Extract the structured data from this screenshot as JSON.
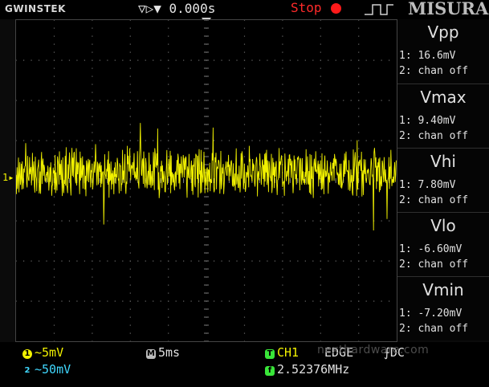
{
  "header": {
    "brand": "GWINSTEK",
    "timebase_offset": "0.000s",
    "run_status": "Stop",
    "logo": "MISURA"
  },
  "channel": {
    "marker": "1",
    "trace_color": "#f2f200"
  },
  "measurements": [
    {
      "title": "Vpp",
      "ch1": "1: 16.6mV",
      "ch2": "2: chan off"
    },
    {
      "title": "Vmax",
      "ch1": "1: 9.40mV",
      "ch2": "2: chan off"
    },
    {
      "title": "Vhi",
      "ch1": "1: 7.80mV",
      "ch2": "2: chan off"
    },
    {
      "title": "Vlo",
      "ch1": "1: -6.60mV",
      "ch2": "2: chan off"
    },
    {
      "title": "Vmin",
      "ch1": "1: -7.20mV",
      "ch2": "2: chan off"
    }
  ],
  "footer": {
    "ch1_badge": "1",
    "ch1_scale": "~5mV",
    "ch2_badge": "2",
    "ch2_scale": "~50mV",
    "time_badge": "M",
    "time_scale": "5ms",
    "trigger_badge": "T",
    "trigger_source": "CH1",
    "trigger_mode": "EDGE",
    "trigger_coupling": "DC",
    "freq_badge": "f",
    "frequency": "2.52376MHz",
    "watermark": "nexthardware.com"
  },
  "colors": {
    "ch1": "#f2f200",
    "ch2": "#40d8ff",
    "stop": "#ff2a2a",
    "trigger": "#39e639"
  }
}
